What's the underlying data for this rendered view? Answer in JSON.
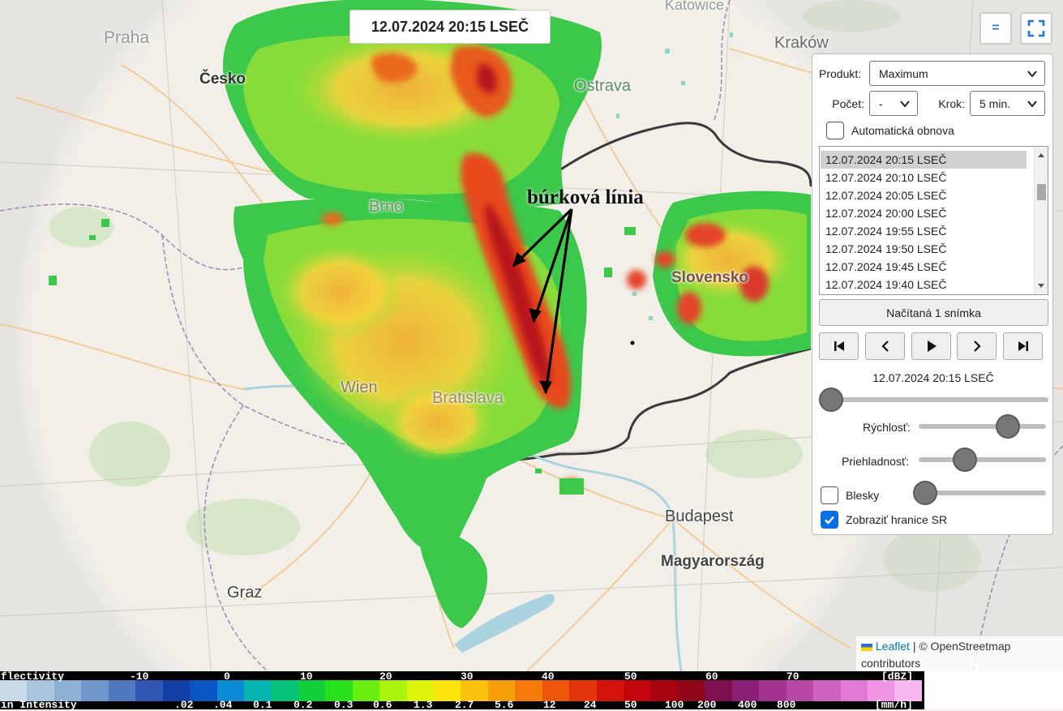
{
  "map": {
    "timestamp": "12.07.2024 20:15 LSEČ",
    "annotation": "búrková línia",
    "places": {
      "katowice": "Katowice",
      "praha": "Praha",
      "krakow": "Kraków",
      "cesko": "Česko",
      "ostrava": "Ostrava",
      "brno": "Brno",
      "slovensko": "Slovensko",
      "wien": "Wien",
      "bratislava": "Bratislava",
      "budapest": "Budapest",
      "magyarorszag": "Magyarország",
      "graz": "Graz"
    },
    "menu_glyph": "=",
    "fullscreen_icon": "fullscreen-icon",
    "attribution_link": "Leaflet",
    "attribution_text": "| © OpenStreetmap contributors"
  },
  "panel": {
    "produkt_label": "Produkt:",
    "produkt_value": "Maximum",
    "pocet_label": "Počet:",
    "pocet_value": "-",
    "krok_label": "Krok:",
    "krok_value": "5 min.",
    "auto_refresh_label": "Automatická obnova",
    "auto_refresh_checked": false,
    "frames": [
      "12.07.2024 20:15 LSEČ",
      "12.07.2024 20:10 LSEČ",
      "12.07.2024 20:05 LSEČ",
      "12.07.2024 20:00 LSEČ",
      "12.07.2024 19:55 LSEČ",
      "12.07.2024 19:50 LSEČ",
      "12.07.2024 19:45 LSEČ",
      "12.07.2024 19:40 LSEČ"
    ],
    "loaded_button": "Načítaná 1 snímka",
    "current_time": "12.07.2024 20:15 LSEČ",
    "speed_label": "Rýchlosť:",
    "opacity_label": "Priehladnosť:",
    "lightning_label": "Blesky",
    "lightning_checked": false,
    "borders_label": "Zobraziť hranice SR",
    "borders_checked": true,
    "time_slider_position": 0,
    "speed_slider_position": 0.7,
    "opacity_slider_position": 0.36,
    "lightning_slider_position": 0.05
  },
  "legend": {
    "reflectivity_label": "flectivity",
    "reflectivity_ticks": [
      "-10",
      "0",
      "10",
      "20",
      "30",
      "40",
      "50",
      "60",
      "70"
    ],
    "reflectivity_unit": "[dBZ]",
    "intensity_label": "in Intensity",
    "intensity_ticks": [
      ".02",
      ".04",
      "0.1",
      "0.2",
      "0.3",
      "0.6",
      "1.3",
      "2.7",
      "5.6",
      "12",
      "24",
      "50",
      "100",
      "200",
      "400",
      "800"
    ],
    "intensity_unit": "[mm/h]",
    "colors": [
      "#c8dce8",
      "#a9c6de",
      "#8db0d5",
      "#6f97cb",
      "#4f79c0",
      "#2f57b3",
      "#1240a6",
      "#0a55c4",
      "#0b8ad6",
      "#06b5b0",
      "#07c27a",
      "#11cf3b",
      "#26e01a",
      "#6aee10",
      "#a8f20c",
      "#dff40b",
      "#fbe40b",
      "#f9c10b",
      "#f89e0b",
      "#f47a0b",
      "#ee560b",
      "#e3330b",
      "#d5150c",
      "#c3060e",
      "#a90510",
      "#8e0618",
      "#7e1050",
      "#8c1f78",
      "#a23390",
      "#b84aa6",
      "#cf62be",
      "#e27ad4",
      "#f195e4",
      "#f8b6ef"
    ]
  }
}
